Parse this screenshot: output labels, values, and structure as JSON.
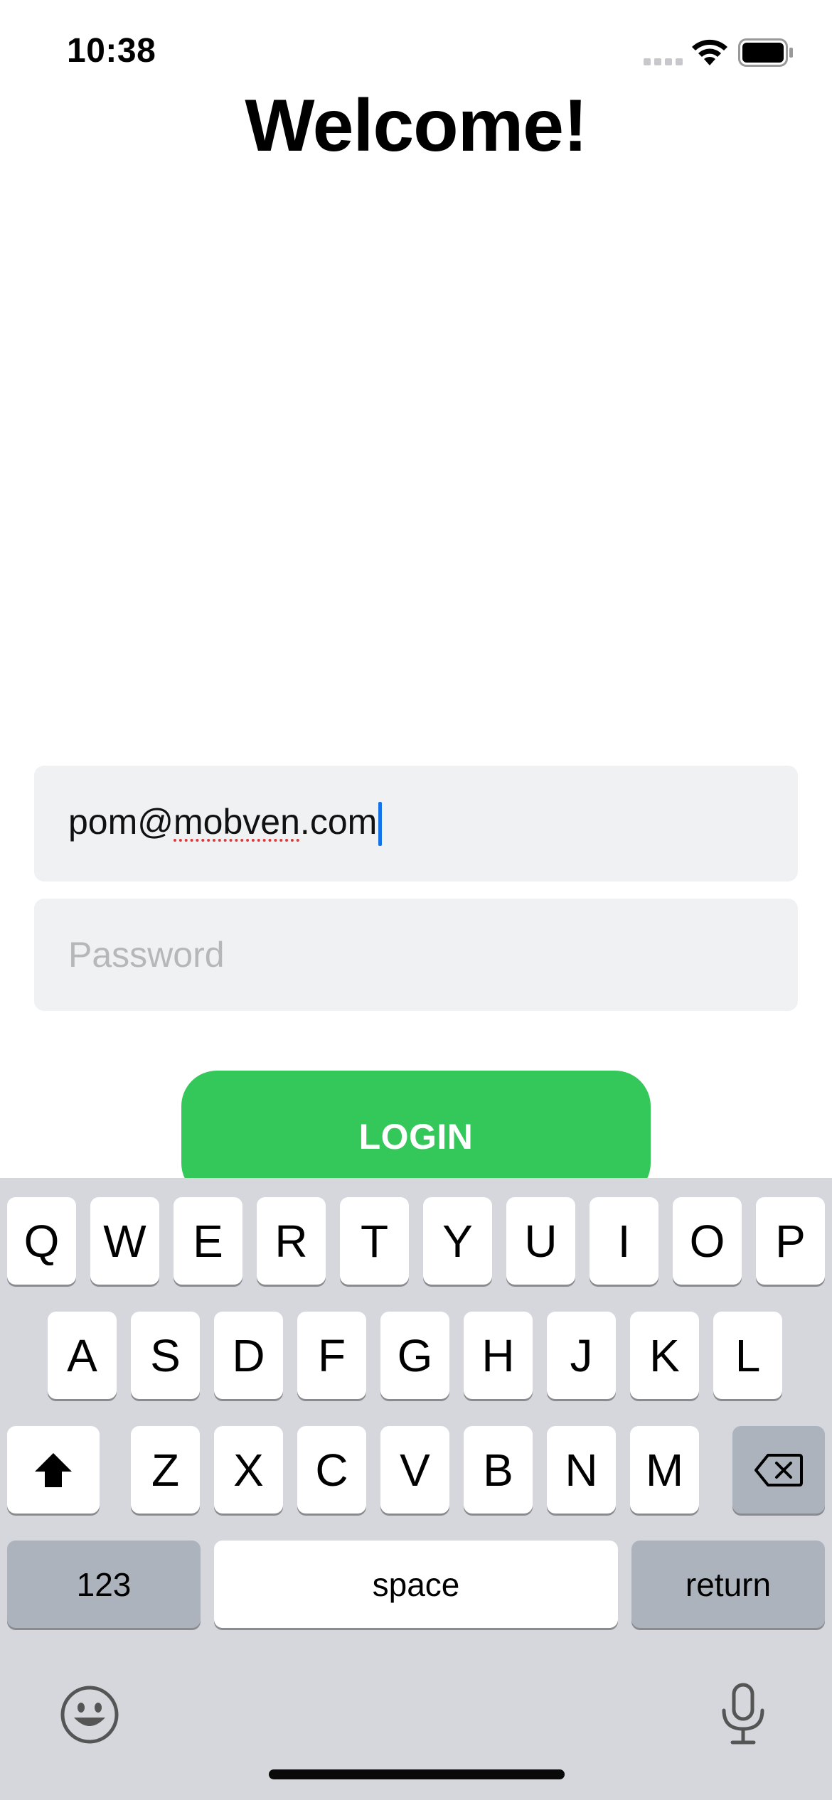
{
  "status_bar": {
    "time": "10:38"
  },
  "page": {
    "title": "Welcome!"
  },
  "form": {
    "email_prefix": "pom@",
    "email_misspelled": "mobven",
    "email_suffix": ".com",
    "password_placeholder": "Password",
    "login_label": "LOGIN"
  },
  "colors": {
    "login_button": "#34c759",
    "field_background": "#eff1f2",
    "cursor": "#1672e8",
    "keyboard_background": "#d5d7dc"
  },
  "keyboard": {
    "row1": [
      "Q",
      "W",
      "E",
      "R",
      "T",
      "Y",
      "U",
      "I",
      "O",
      "P"
    ],
    "row2": [
      "A",
      "S",
      "D",
      "F",
      "G",
      "H",
      "J",
      "K",
      "L"
    ],
    "row3": [
      "Z",
      "X",
      "C",
      "V",
      "B",
      "N",
      "M"
    ],
    "numbers_label": "123",
    "space_label": "space",
    "return_label": "return",
    "shift_icon": "shift-icon",
    "delete_icon": "delete-icon",
    "emoji_icon": "emoji-icon",
    "mic_icon": "microphone-icon"
  }
}
